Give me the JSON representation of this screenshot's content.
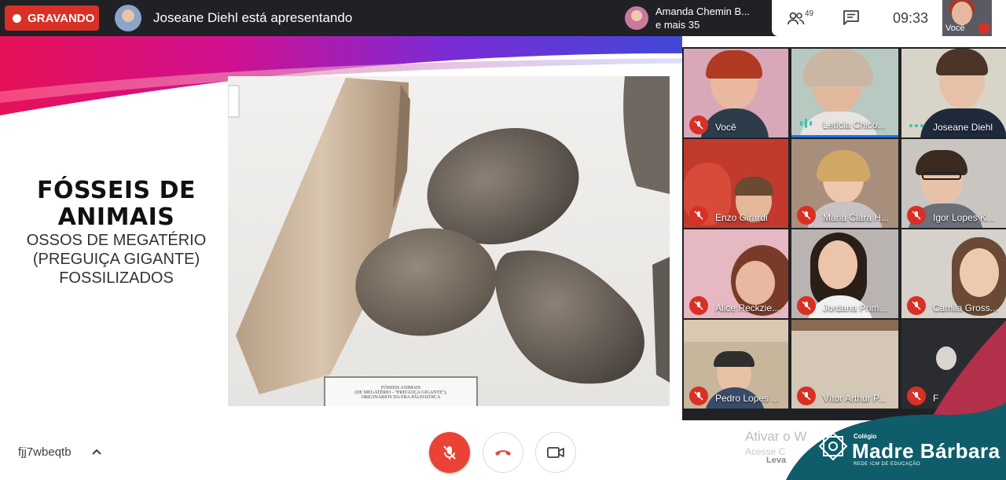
{
  "topbar": {
    "recording_label": "GRAVANDO",
    "presenter_text": "Joseane Diehl está apresentando",
    "viewer_name": "Amanda Chemin B...",
    "viewer_more": "e mais 35",
    "people_count": "49",
    "clock": "09:33",
    "self_label": "Você"
  },
  "slide": {
    "title": "FÓSSEIS DE ANIMAIS",
    "subtitle_lines": [
      "OSSOS DE MEGATÉRIO",
      "(PREGUIÇA GIGANTE)",
      "FOSSILIZADOS"
    ],
    "plaque_lines": [
      "FÓSSEIS ANIMAIS",
      "(DE MEGATÉRIO - \"PREGUIÇA GIGANTE\"),",
      "ORIGINÁRIOS DA ERA PALEOZÓICA"
    ]
  },
  "participants": [
    {
      "name": "Você",
      "state": "muted"
    },
    {
      "name": "Letícia Chico...",
      "state": "speaking"
    },
    {
      "name": "Joseane Diehl",
      "state": "presenting"
    },
    {
      "name": "Enzo Girardi",
      "state": "muted"
    },
    {
      "name": "Maria Clara H...",
      "state": "muted"
    },
    {
      "name": "Igor Lopes K...",
      "state": "muted"
    },
    {
      "name": "Alice Reckzie...",
      "state": "muted"
    },
    {
      "name": "Jordana Prim...",
      "state": "muted"
    },
    {
      "name": "Camila Gross...",
      "state": "muted"
    },
    {
      "name": "Pedro Lopes ...",
      "state": "muted"
    },
    {
      "name": "Vítor Arthur P...",
      "state": "muted"
    },
    {
      "name": "F",
      "state": "muted"
    }
  ],
  "bottombar": {
    "meeting_code": "fjj7wbeqtb",
    "activate_title": "Ativar o W",
    "activate_sub": "Acesse C",
    "activate_sub2": "Leva"
  },
  "logo": {
    "small": "Colégio",
    "main": "Madre Bárbara",
    "tag": "REDE ICM DE EDUCAÇÃO"
  },
  "colors": {
    "recording": "#d93025",
    "topbar": "#202124",
    "logo_teal": "#0f5d6a",
    "logo_red": "#b3304a"
  }
}
